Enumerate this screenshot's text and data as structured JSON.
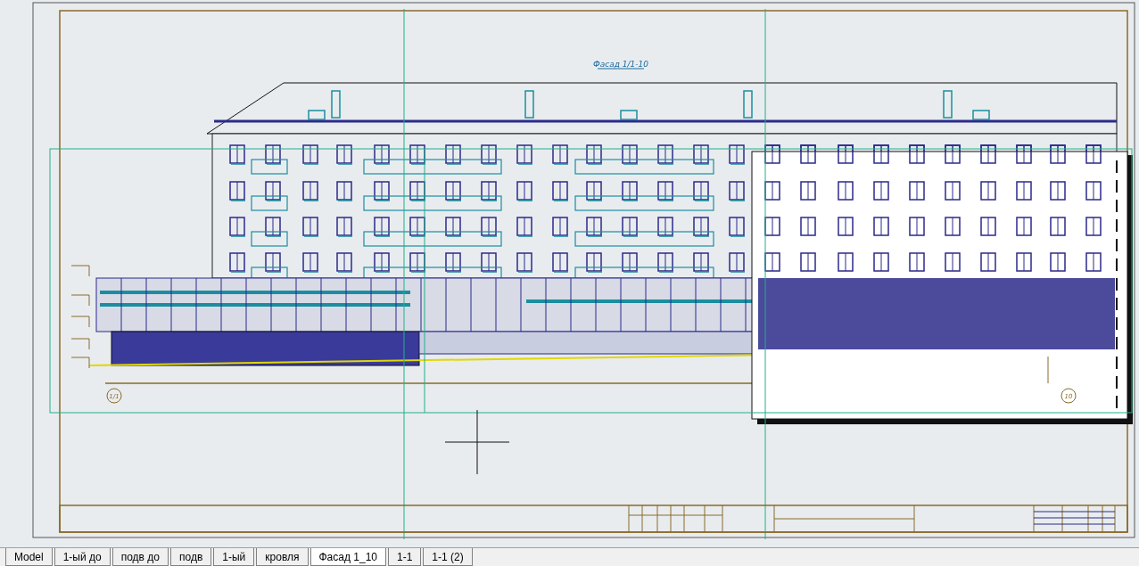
{
  "drawing": {
    "title": "Фасад 1/1-10",
    "axes": [
      {
        "label": "1/1"
      },
      {
        "label": "10"
      }
    ]
  },
  "tabs": [
    {
      "label": "Model",
      "selected": false
    },
    {
      "label": "1-ый до",
      "selected": false
    },
    {
      "label": "подв до",
      "selected": false
    },
    {
      "label": "подв",
      "selected": false
    },
    {
      "label": "1-ый",
      "selected": false
    },
    {
      "label": "кровля",
      "selected": false
    },
    {
      "label": "Фасад 1_10",
      "selected": true
    },
    {
      "label": "1-1",
      "selected": false
    },
    {
      "label": "1-1 (2)",
      "selected": false
    }
  ]
}
